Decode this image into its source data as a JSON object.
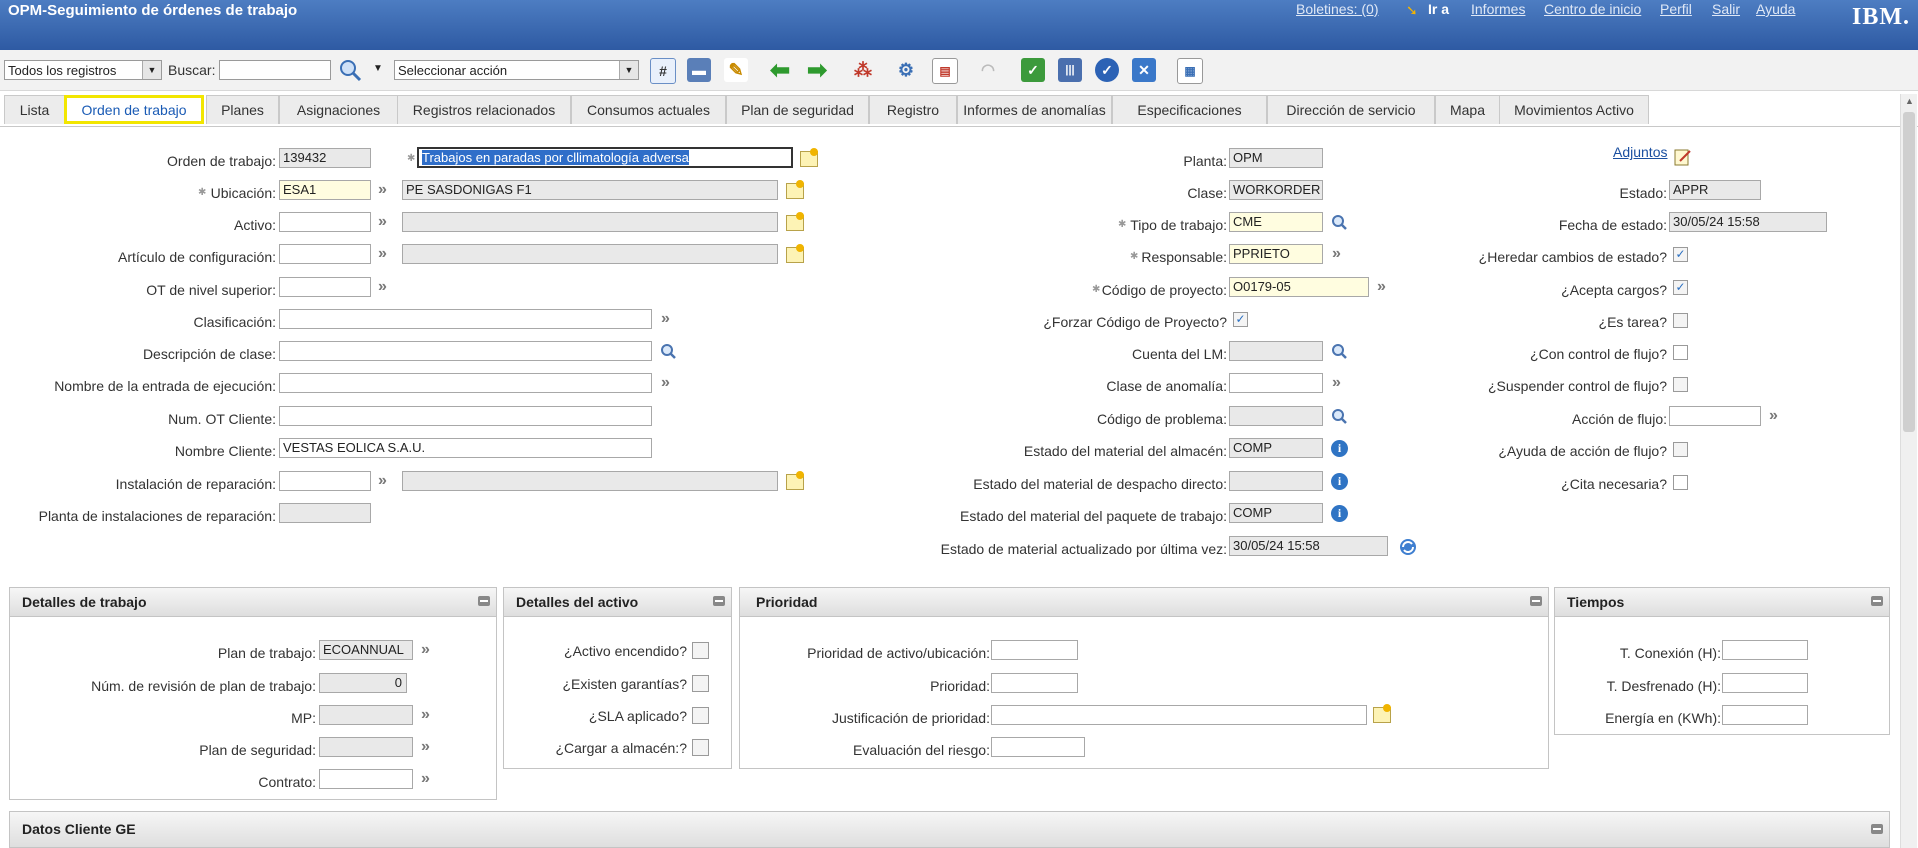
{
  "header": {
    "title": "OPM-Seguimiento de órdenes de trabajo",
    "boletines": "Boletines: (0)",
    "ir_a": "Ir a",
    "informes": "Informes",
    "centro": "Centro de inicio",
    "perfil": "Perfil",
    "salir": "Salir",
    "ayuda": "Ayuda",
    "logo": "IBM."
  },
  "toolbar": {
    "query_value": "Todos los registros",
    "buscar_label": "Buscar:",
    "search_value": "",
    "action_value": "Seleccionar acción"
  },
  "tabs": [
    "Lista",
    "Orden de trabajo",
    "Planes",
    "Asignaciones",
    "Registros relacionados",
    "Consumos actuales",
    "Plan de seguridad",
    "Registro",
    "Informes de anomalías",
    "Especificaciones",
    "Dirección de servicio",
    "Mapa",
    "Movimientos Activo"
  ],
  "left": {
    "orden_label": "Orden de trabajo:",
    "orden_value": "139432",
    "desc_value": "Trabajos en paradas por cllimatología adversa",
    "ubicacion_label": "Ubicación:",
    "ubicacion_value": "ESA1",
    "ubicacion_desc": "PE SASDONIGAS F1",
    "activo_label": "Activo:",
    "articulo_label": "Artículo de configuración:",
    "ot_sup_label": "OT de nivel superior:",
    "clasificacion_label": "Clasificación:",
    "desc_clase_label": "Descripción de clase:",
    "entrada_label": "Nombre de la entrada de ejecución:",
    "num_ot_label": "Num. OT Cliente:",
    "nombre_cliente_label": "Nombre Cliente:",
    "nombre_cliente_value": "VESTAS EOLICA S.A.U.",
    "instalacion_label": "Instalación de reparación:",
    "planta_inst_label": "Planta de instalaciones de reparación:"
  },
  "middle": {
    "planta_label": "Planta:",
    "planta_value": "OPM",
    "clase_label": "Clase:",
    "clase_value": "WORKORDER",
    "tipo_label": "Tipo de trabajo:",
    "tipo_value": "CME",
    "responsable_label": "Responsable:",
    "responsable_value": "PPRIETO",
    "codigo_proy_label": "Código de proyecto:",
    "codigo_proy_value": "O0179-05",
    "forzar_label": "¿Forzar Código de Proyecto?",
    "cuenta_label": "Cuenta del LM:",
    "clase_anom_label": "Clase de anomalía:",
    "codigo_prob_label": "Código de problema:",
    "est_almacen_label": "Estado del material del almacén:",
    "est_almacen_value": "COMP",
    "est_despacho_label": "Estado del material de despacho directo:",
    "est_paquete_label": "Estado del material del paquete de trabajo:",
    "est_paquete_value": "COMP",
    "est_actualizado_label": "Estado de material actualizado por última vez:",
    "est_actualizado_value": "30/05/24 15:58"
  },
  "right": {
    "adjuntos": "Adjuntos",
    "estado_label": "Estado:",
    "estado_value": "APPR",
    "fecha_label": "Fecha de estado:",
    "fecha_value": "30/05/24 15:58",
    "heredar_label": "¿Heredar cambios de estado?",
    "acepta_label": "¿Acepta cargos?",
    "tarea_label": "¿Es tarea?",
    "control_label": "¿Con control de flujo?",
    "suspender_label": "¿Suspender control de flujo?",
    "accion_label": "Acción de flujo:",
    "ayuda_label": "¿Ayuda de acción de flujo?",
    "cita_label": "¿Cita necesaria?"
  },
  "detalles_trabajo": {
    "title": "Detalles de trabajo",
    "plan_label": "Plan de trabajo:",
    "plan_value": "ECOANNUAL",
    "rev_label": "Núm. de revisión de plan de trabajo:",
    "rev_value": "0",
    "mp_label": "MP:",
    "seg_label": "Plan de seguridad:",
    "contrato_label": "Contrato:"
  },
  "detalles_activo": {
    "title": "Detalles del activo",
    "encendido_label": "¿Activo encendido?",
    "garantias_label": "¿Existen garantías?",
    "sla_label": "¿SLA aplicado?",
    "almacen_label": "¿Cargar a almacén:?"
  },
  "prioridad": {
    "title": "Prioridad",
    "prio_act_label": "Prioridad de activo/ubicación:",
    "prio_label": "Prioridad:",
    "just_label": "Justificación de prioridad:",
    "eval_label": "Evaluación del riesgo:"
  },
  "tiempos": {
    "title": "Tiempos",
    "conexion_label": "T. Conexión (H):",
    "desfrenado_label": "T. Desfrenado (H):",
    "energia_label": "Energía en (KWh):"
  },
  "datos_cliente": {
    "title": "Datos Cliente GE"
  }
}
